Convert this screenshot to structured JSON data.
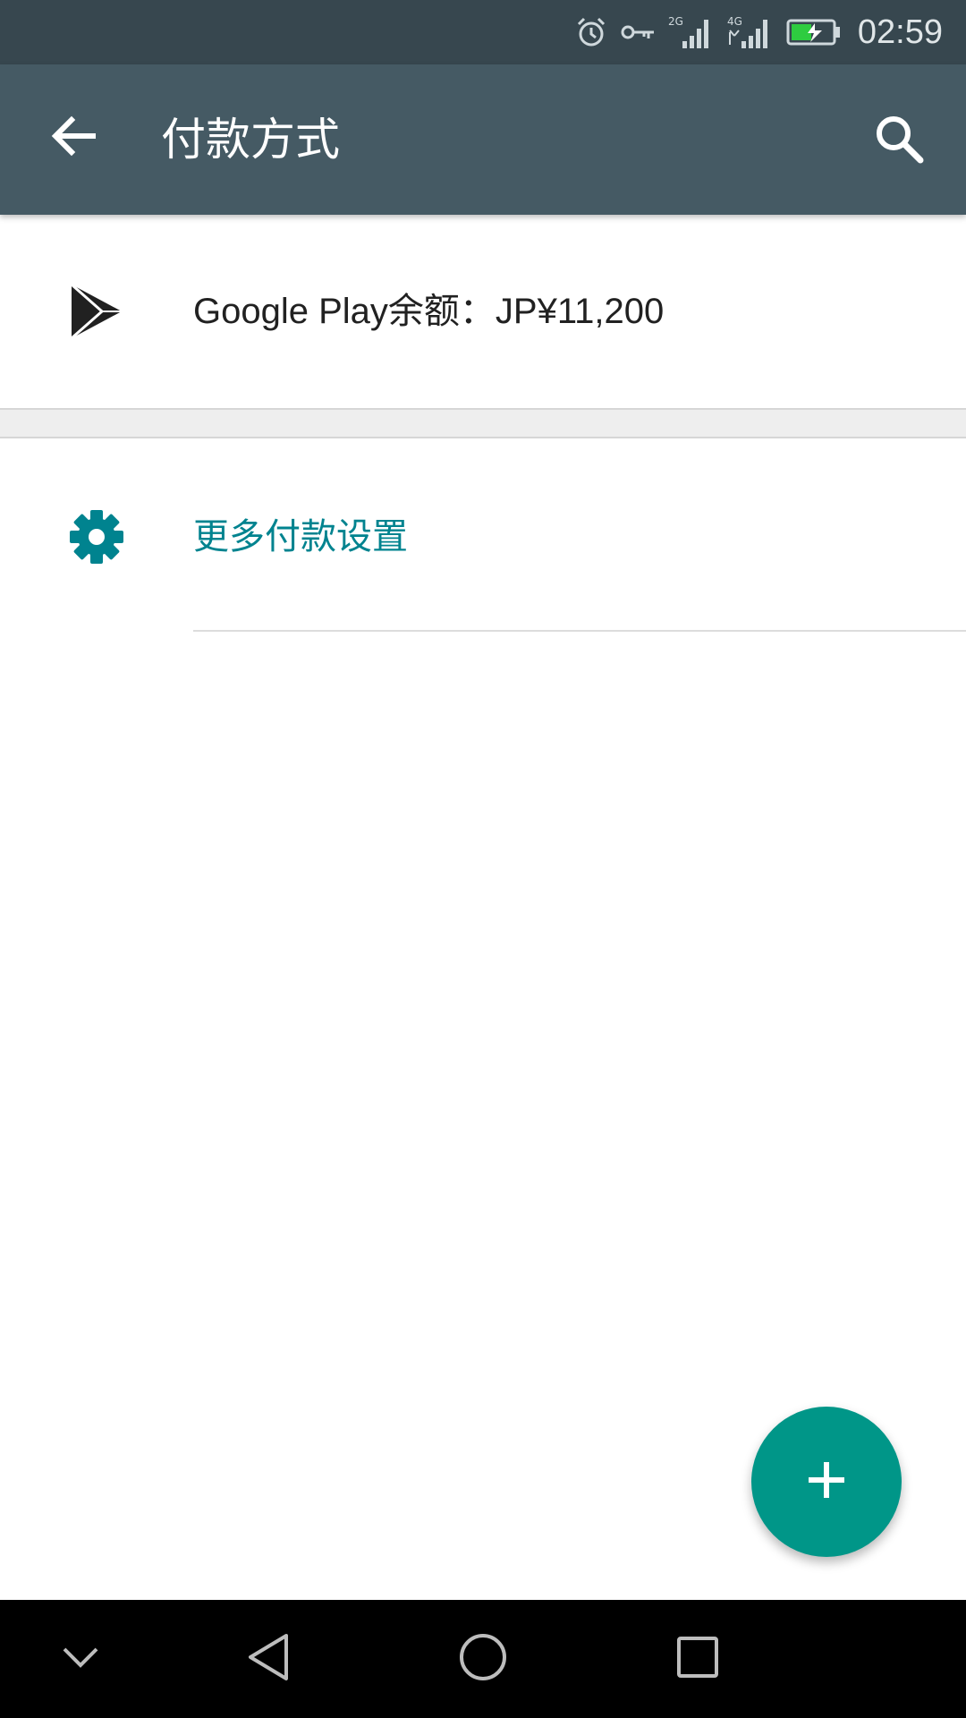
{
  "status_bar": {
    "time": "02:59",
    "icons": [
      "alarm-icon",
      "vpn-key-icon",
      "signal-2g-icon",
      "signal-4g-icon",
      "battery-charging-icon"
    ],
    "network_labels": {
      "sim1": "2G",
      "sim2": "4G"
    }
  },
  "app_bar": {
    "title": "付款方式",
    "back_icon": "arrow-back-icon",
    "search_icon": "search-icon"
  },
  "payment": {
    "balance_label": "Google Play余额：JP¥11,200",
    "balance_icon": "google-play-icon"
  },
  "settings": {
    "label": "更多付款设置",
    "icon": "gear-icon"
  },
  "fab": {
    "icon": "plus-icon"
  },
  "nav_bar": {
    "buttons": [
      "hide-nav-icon",
      "back-triangle-icon",
      "home-circle-icon",
      "recents-square-icon"
    ]
  },
  "colors": {
    "status_bar": "#37474f",
    "app_bar": "#455a64",
    "accent": "#009688",
    "settings_text": "#00838f"
  }
}
